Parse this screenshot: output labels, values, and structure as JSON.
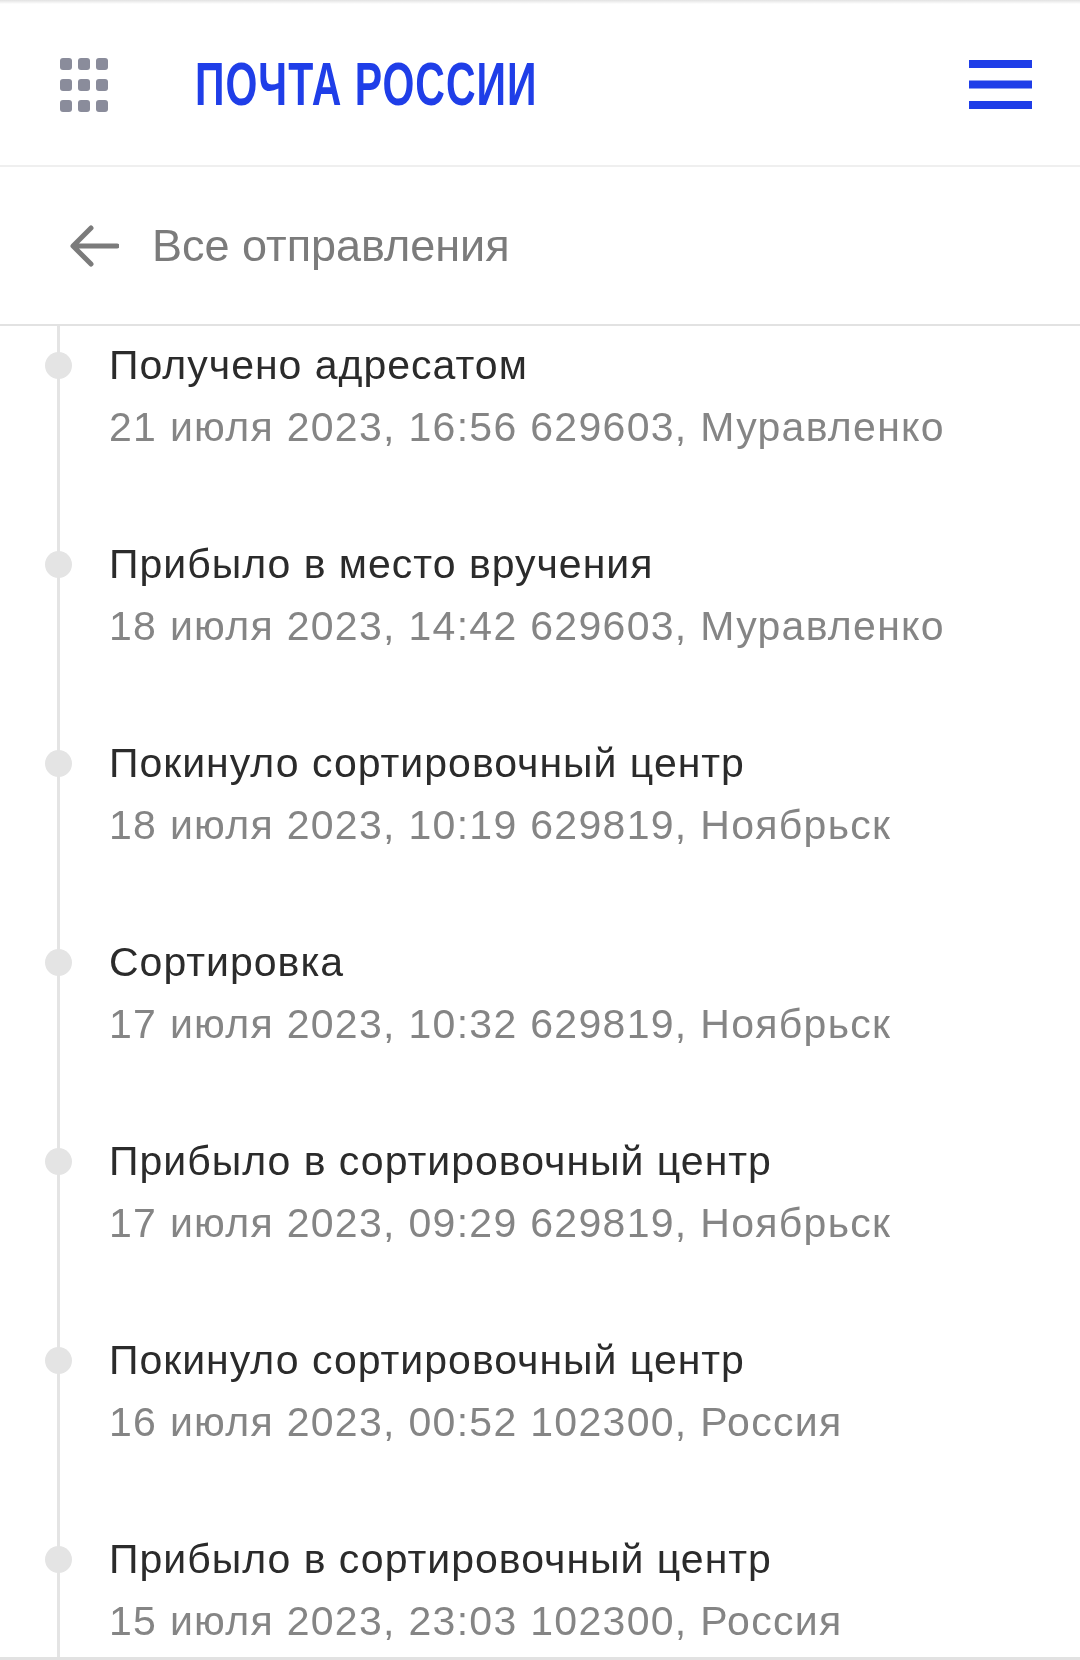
{
  "header": {
    "logo": "ПОЧТА РОССИИ"
  },
  "back_link": {
    "label": "Все отправления"
  },
  "events": [
    {
      "status": "Получено адресатом",
      "details": "21 июля 2023, 16:56 629603, Муравленко"
    },
    {
      "status": "Прибыло в место вручения",
      "details": "18 июля 2023, 14:42 629603, Муравленко"
    },
    {
      "status": "Покинуло сортировочный центр",
      "details": "18 июля 2023, 10:19 629819, Ноябрьск"
    },
    {
      "status": "Сортировка",
      "details": "17 июля 2023, 10:32 629819, Ноябрьск"
    },
    {
      "status": "Прибыло в сортировочный центр",
      "details": "17 июля 2023, 09:29 629819, Ноябрьск"
    },
    {
      "status": "Покинуло сортировочный центр",
      "details": "16 июля 2023, 00:52 102300, Россия"
    },
    {
      "status": "Прибыло в сортировочный центр",
      "details": "15 июля 2023, 23:03 102300, Россия"
    }
  ]
}
